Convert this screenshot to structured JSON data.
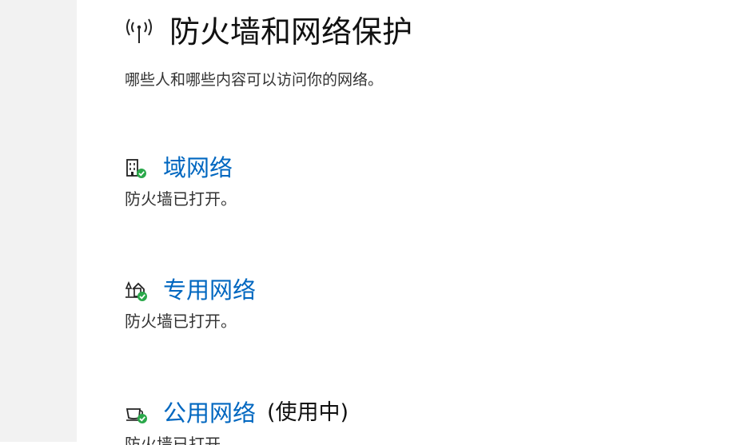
{
  "page": {
    "title": "防火墙和网络保护",
    "description": "哪些人和哪些内容可以访问你的网络。",
    "icon": "wireless-antenna-icon"
  },
  "networks": [
    {
      "name": "域网络",
      "suffix": "",
      "status": "防火墙已打开。",
      "icon": "domain-building-icon",
      "badge": "green-check-badge"
    },
    {
      "name": "专用网络",
      "suffix": "",
      "status": "防火墙已打开。",
      "icon": "private-home-network-icon",
      "badge": "green-check-badge"
    },
    {
      "name": "公用网络",
      "suffix": "(使用中)",
      "status": "防火墙已打开。",
      "icon": "public-coffee-cup-icon",
      "badge": "green-check-badge"
    }
  ],
  "colors": {
    "link": "#0067c0",
    "check": "#2aa84a",
    "sidebar": "#f2f2f2"
  }
}
